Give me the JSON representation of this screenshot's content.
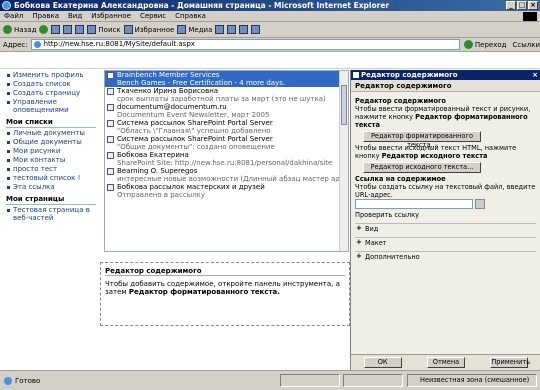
{
  "window": {
    "title": "Бобкова Екатерина Александровна - Домашняя страница - Microsoft Internet Explorer"
  },
  "menu": [
    "Файл",
    "Правка",
    "Вид",
    "Избранное",
    "Сервис",
    "Справка"
  ],
  "toolbar": {
    "back": "Назад",
    "search": "Поиск",
    "favorites": "Избранное",
    "media": "Медиа"
  },
  "address": {
    "label": "Адрес:",
    "url": "http://new.hse.ru:8081/MySite/default.aspx",
    "go": "Переход",
    "links": "Ссылки"
  },
  "nav": {
    "top": [
      "Изменить профиль",
      "Создать список",
      "Создать страницу",
      "Управление оповещениями"
    ],
    "lists_title": "Мои списки",
    "lists": [
      "Личные документы",
      "Общие документы",
      "Мои рисунки",
      "Мои контакты",
      "просто тест",
      "тестовый список !",
      "Эта ссылка"
    ],
    "pages_title": "Мои страницы",
    "pages": [
      "Тестовая страница в веб-частей"
    ]
  },
  "feed": [
    {
      "l1": "Brainbench Member Services",
      "l2": "Bench Games - Free Certification - 4 more days.",
      "sel": true
    },
    {
      "l1": "Ткаченко Ирина Борисовна",
      "l2": "срок выплаты заработной платы за март (это не шутка)"
    },
    {
      "l1": "documentum@documentum.ru",
      "l2": "Documentum Event Newsletter, март 2005"
    },
    {
      "l1": "Система рассылок SharePoint Portal Server",
      "l2": "\"Область \\\"Главная\\\" успешно добавлено"
    },
    {
      "l1": "Система рассылок SharePoint Portal Server",
      "l2": "\"Общие документы\": создано оповещение"
    },
    {
      "l1": "Бобкова Екатерина",
      "l2": "SharePoint Site: http://new.hse.ru:8081/personal/dakhina/site"
    },
    {
      "l1": "Bearning O. Superegos",
      "l2": "интересные новые возможности (Длинный абзац мастер адр"
    },
    {
      "l1": "Бобкова рассылок мастерских и друзей",
      "l2": "Отправлено в рассылку"
    }
  ],
  "ce_box": {
    "title": "Редактор содержимого",
    "text": "Чтобы добавить содержимое, откройте панель инструмента, а затем ",
    "bold": "Редактор форматированного текста."
  },
  "pane": {
    "title": "Редактор содержимого",
    "subtitle": "Редактор содержимого",
    "section1": "Редактор содержимого",
    "p1": "Чтобы ввести форматированный текст и рисунки, нажмите кнопку ",
    "p1b": "Редактор форматированного текста",
    "btn1": "Редактор форматированного текста...",
    "p2": "Чтобы ввести исходный текст HTML, нажмите кнопку ",
    "p2b": "Редактор исходного текста",
    "btn2": "Редактор исходного текста...",
    "link_title": "Ссылка на содержимое",
    "link_text": "Чтобы создать ссылку на текстовый файл, введите URL-адрес.",
    "test_link": "Проверить ссылку",
    "collapsed": [
      "Вид",
      "Макет",
      "Дополнительно"
    ],
    "ok": "ОК",
    "cancel": "Отмена",
    "apply": "Применить"
  },
  "status": {
    "text": "Готово",
    "zone": "Неизвестная зона (смешанное)"
  }
}
